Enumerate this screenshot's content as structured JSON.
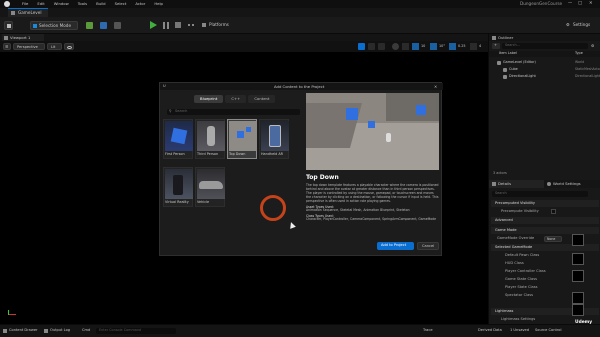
{
  "menubar": {
    "items": [
      "File",
      "Edit",
      "Window",
      "Tools",
      "Build",
      "Select",
      "Actor",
      "Help"
    ],
    "project": "DungeonGenCourse"
  },
  "tab": {
    "label": "GameLevel"
  },
  "toolbar": {
    "save_label": "Save",
    "mode_label": "Selection Mode",
    "platforms_label": "Platforms",
    "settings_label": "Settings"
  },
  "viewport": {
    "tab_label": "Viewport 1",
    "perspective": "Perspective",
    "lit": "Lit",
    "snap_value": "10",
    "angle_value": "10°",
    "scale_value": "0.25",
    "speed": "4"
  },
  "outliner": {
    "title": "Outliner",
    "search_placeholder": "Search...",
    "col_item": "Item Label",
    "col_type": "Type",
    "rows": [
      {
        "label": "GameLevel (Editor)",
        "type": "World"
      },
      {
        "label": "Cube",
        "type": "StaticMeshActor"
      },
      {
        "label": "DirectionalLight",
        "type": "DirectionalLight"
      }
    ],
    "count": "3 actors"
  },
  "details": {
    "tab_details": "Details",
    "tab_world": "World Settings",
    "search_placeholder": "Search",
    "sections": [
      {
        "title": "Precomputed Visibility"
      },
      {
        "title": "Advanced"
      },
      {
        "title": "Game Mode"
      },
      {
        "title": "Selected GameMode"
      }
    ],
    "rows": [
      "Precompute Visibility",
      "GameMode Override",
      "Default Pawn Class",
      "HUD Class",
      "Player Controller Class",
      "Game State Class",
      "Player State Class",
      "Spectator Class",
      "Lightmass",
      "Lightmass Settings"
    ],
    "gamemode_value": "None"
  },
  "dialog": {
    "title": "Add Content to the Project",
    "tabs": [
      "Blueprint",
      "C++",
      "Content"
    ],
    "active_tab": "Blueprint",
    "search_placeholder": "Search",
    "templates": [
      "First Person",
      "Third Person",
      "Top Down",
      "Handheld AR",
      "Virtual Reality",
      "Vehicle"
    ],
    "selected": "Top Down",
    "heading": "Top Down",
    "description": "The top down template features a playable character where the camera is positioned behind and above the avatar at greater distance than in third person perspectives. The player is controlled by using the mouse, gamepad, or touchscreen and moves the character by clicking on a destination, or following the cursor if input is held. This perspective is often used in action role playing games.",
    "asset_types_label": "Asset Types Used:",
    "asset_types": "Animation Sequence, Skeletal Mesh, Animation Blueprint, Skeleton",
    "class_types_label": "Class Types Used:",
    "class_types": "Character, PlayerController, CameraComponent, SpringArmComponent, GameMode",
    "add_button": "Add to Project",
    "cancel_button": "Cancel"
  },
  "bottombar": {
    "content_drawer": "Content Drawer",
    "output_log": "Output Log",
    "cmd": "Cmd",
    "cmd_placeholder": "Enter Console Command",
    "trace": "Trace",
    "derived_data": "Derived Data",
    "unsaved": "1 Unsaved",
    "source_control": "Source Control",
    "watermark": "Udemy"
  },
  "colors": {
    "play": "#3fb040",
    "accent_blue": "#0a6ed1",
    "active_tab_blue": "#1a5fa0",
    "recording_ring": "#c4431a"
  }
}
